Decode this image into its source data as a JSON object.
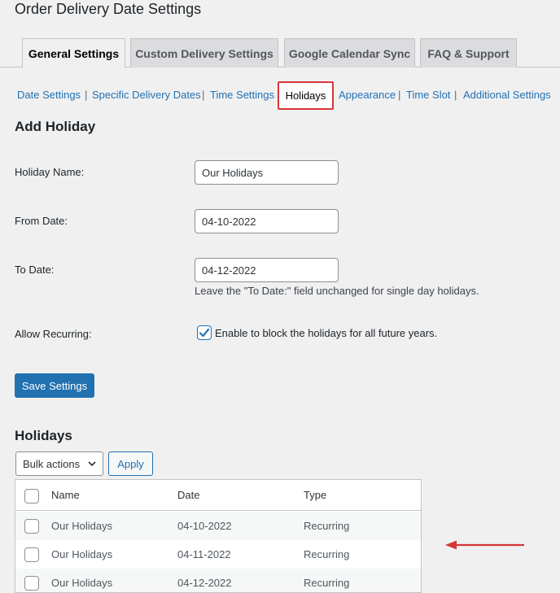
{
  "page": {
    "title": "Order Delivery Date Settings"
  },
  "tabs": [
    "General Settings",
    "Custom Delivery Settings",
    "Google Calendar Sync",
    "FAQ & Support"
  ],
  "subnav": {
    "items": [
      "Date Settings",
      "Specific Delivery Dates",
      "Time Settings",
      "Holidays",
      "Appearance",
      "Time Slot",
      "Additional Settings"
    ],
    "separator": "|"
  },
  "add_holiday": {
    "heading": "Add Holiday",
    "name_label": "Holiday Name:",
    "name_value": "Our Holidays",
    "from_label": "From Date:",
    "from_value": "04-10-2022",
    "to_label": "To Date:",
    "to_value": "04-12-2022",
    "to_help": "Leave the \"To Date:\" field unchanged for single day holidays.",
    "recurring_label": "Allow Recurring:",
    "recurring_text": "Enable to block the holidays for all future years.",
    "save_label": "Save Settings"
  },
  "holidays": {
    "heading": "Holidays",
    "bulk_actions": "Bulk actions",
    "apply_label": "Apply",
    "columns": [
      "Name",
      "Date",
      "Type"
    ],
    "rows": [
      {
        "name": "Our Holidays",
        "date": "04-10-2022",
        "type": "Recurring"
      },
      {
        "name": "Our Holidays",
        "date": "04-11-2022",
        "type": "Recurring"
      },
      {
        "name": "Our Holidays",
        "date": "04-12-2022",
        "type": "Recurring"
      }
    ]
  },
  "colors": {
    "accent": "#2271b1",
    "highlight": "#d63638",
    "annotation_arrow": "#d63638"
  },
  "icons": {
    "checkmark": "checkmark-icon",
    "dropdown": "chevron-down-icon",
    "arrow": "arrow-left-icon"
  }
}
